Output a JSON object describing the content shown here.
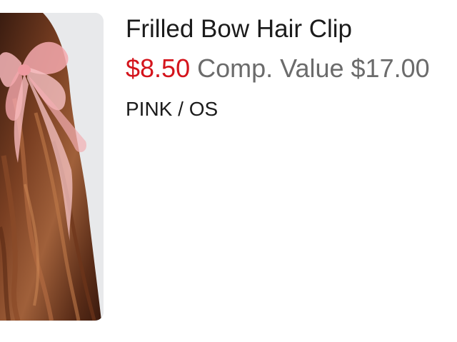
{
  "product": {
    "title": "Frilled Bow Hair Clip",
    "price": "$8.50",
    "comp_value": "Comp. Value $17.00",
    "variant": "PINK / OS",
    "image_icon": "product-photo-hair-bow"
  },
  "colors": {
    "sale_price": "#d4141c",
    "comp_value": "#6b6b6b",
    "text": "#1b1b1b"
  }
}
